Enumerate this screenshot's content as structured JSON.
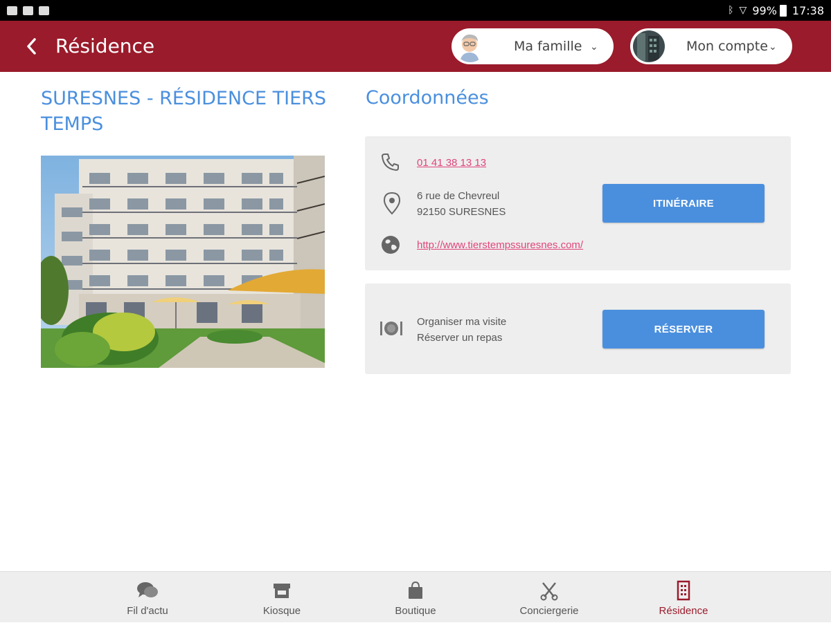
{
  "status_bar": {
    "battery": "99%",
    "time": "17:38"
  },
  "header": {
    "title": "Résidence",
    "family_label": "Ma famille",
    "account_label": "Mon compte"
  },
  "residence": {
    "name": "SURESNES - RÉSIDENCE TIERS TEMPS"
  },
  "coordinates": {
    "title": "Coordonnées",
    "phone": "01 41 38 13 13",
    "address_line1": "6 rue de Chevreul",
    "address_line2": "92150 SURESNES",
    "website": "http://www.tierstempssuresnes.com/",
    "itinerary_button": "ITINÉRAIRE"
  },
  "booking": {
    "line1": "Organiser ma visite",
    "line2": "Réserver un repas",
    "reserve_button": "RÉSERVER"
  },
  "bottom_nav": {
    "items": [
      {
        "label": "Fil d'actu",
        "icon": "chat-bubbles-icon"
      },
      {
        "label": "Kiosque",
        "icon": "storefront-icon"
      },
      {
        "label": "Boutique",
        "icon": "shopping-bag-icon"
      },
      {
        "label": "Conciergerie",
        "icon": "scissors-icon"
      },
      {
        "label": "Résidence",
        "icon": "building-icon"
      }
    ],
    "active_color": "#9a1b2b"
  },
  "colors": {
    "brand": "#9a1b2b",
    "accent": "#4a8fde",
    "link": "#e0457b"
  }
}
